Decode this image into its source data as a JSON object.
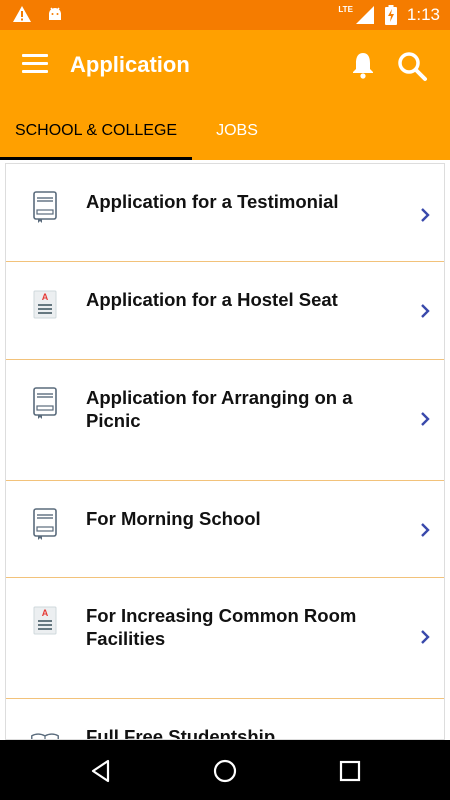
{
  "status_bar": {
    "time": "1:13",
    "network_label": "LTE",
    "left_icons": [
      "warning-icon",
      "android-icon"
    ],
    "right_icons": [
      "signal-icon",
      "battery-charging-icon"
    ]
  },
  "app_bar": {
    "title": "Application",
    "icons": [
      "menu-icon",
      "bell-icon",
      "search-icon"
    ],
    "color": "#ffa000"
  },
  "tabs": [
    {
      "label": "SCHOOL & COLLEGE",
      "active": true
    },
    {
      "label": "JOBS",
      "active": false
    }
  ],
  "list": {
    "items": [
      {
        "title": "Application for a Testimonial",
        "icon": "book-icon"
      },
      {
        "title": "Application for a Hostel Seat",
        "icon": "document-icon"
      },
      {
        "title": "Application for Arranging on a Picnic",
        "icon": "book-icon"
      },
      {
        "title": "For Morning School",
        "icon": "book-icon"
      },
      {
        "title": "For Increasing Common Room Facilities",
        "icon": "document-icon"
      },
      {
        "title": "Full Free Studentship",
        "icon": "open-book-icon"
      }
    ],
    "divider_color": "#f2c27a",
    "chevron_color": "#3949ab"
  },
  "nav_bar": {
    "buttons": [
      "back-icon",
      "home-icon",
      "recents-icon"
    ]
  }
}
